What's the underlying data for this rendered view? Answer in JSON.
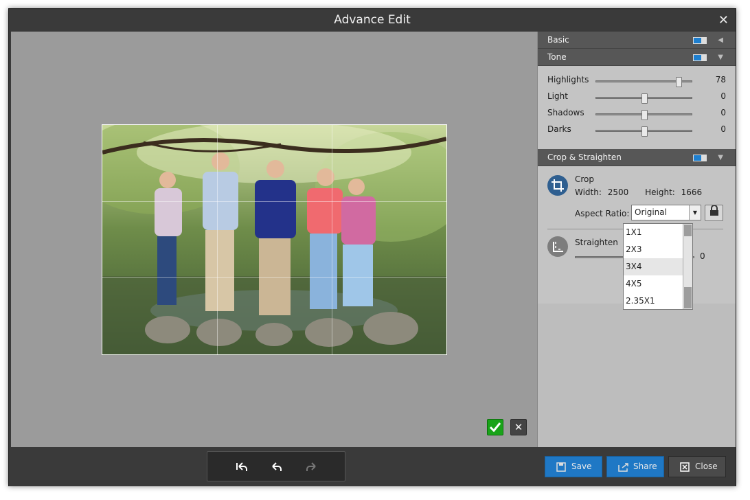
{
  "window": {
    "title": "Advance Edit",
    "close_glyph": "✕"
  },
  "canvas": {
    "confirm_icon": "check-icon",
    "cancel_icon": "close-icon",
    "cancel_glyph": "✕"
  },
  "panel": {
    "basic": {
      "title": "Basic",
      "toggle_on": true,
      "arrow": "◀"
    },
    "tone": {
      "title": "Tone",
      "toggle_on": true,
      "arrow": "▼",
      "sliders": [
        {
          "label": "Highlights",
          "value": "78",
          "fraction": 0.86
        },
        {
          "label": "Light",
          "value": "0",
          "fraction": 0.5
        },
        {
          "label": "Shadows",
          "value": "0",
          "fraction": 0.5
        },
        {
          "label": "Darks",
          "value": "0",
          "fraction": 0.5
        }
      ]
    },
    "crop": {
      "title": "Crop & Straighten",
      "toggle_on": true,
      "arrow": "▼",
      "crop_label": "Crop",
      "width_label": "Width:",
      "width_value": "2500",
      "height_label": "Height:",
      "height_value": "1666",
      "aspect_label": "Aspect Ratio:",
      "aspect_selected": "Original",
      "aspect_options": [
        "1X1",
        "2X3",
        "3X4",
        "4X5",
        "2.35X1"
      ],
      "aspect_highlighted": "3X4",
      "straighten_label": "Straighten",
      "straighten_value": "0"
    }
  },
  "history": {
    "undo_all_icon": "undo-all-icon",
    "undo_icon": "undo-icon",
    "redo_icon": "redo-icon"
  },
  "buttons": {
    "save": "Save",
    "share": "Share",
    "close": "Close"
  },
  "colors": {
    "accent": "#1f78c5",
    "confirm": "#19a319",
    "panel_bg": "#c4c4c4",
    "header_bg": "#575757"
  }
}
